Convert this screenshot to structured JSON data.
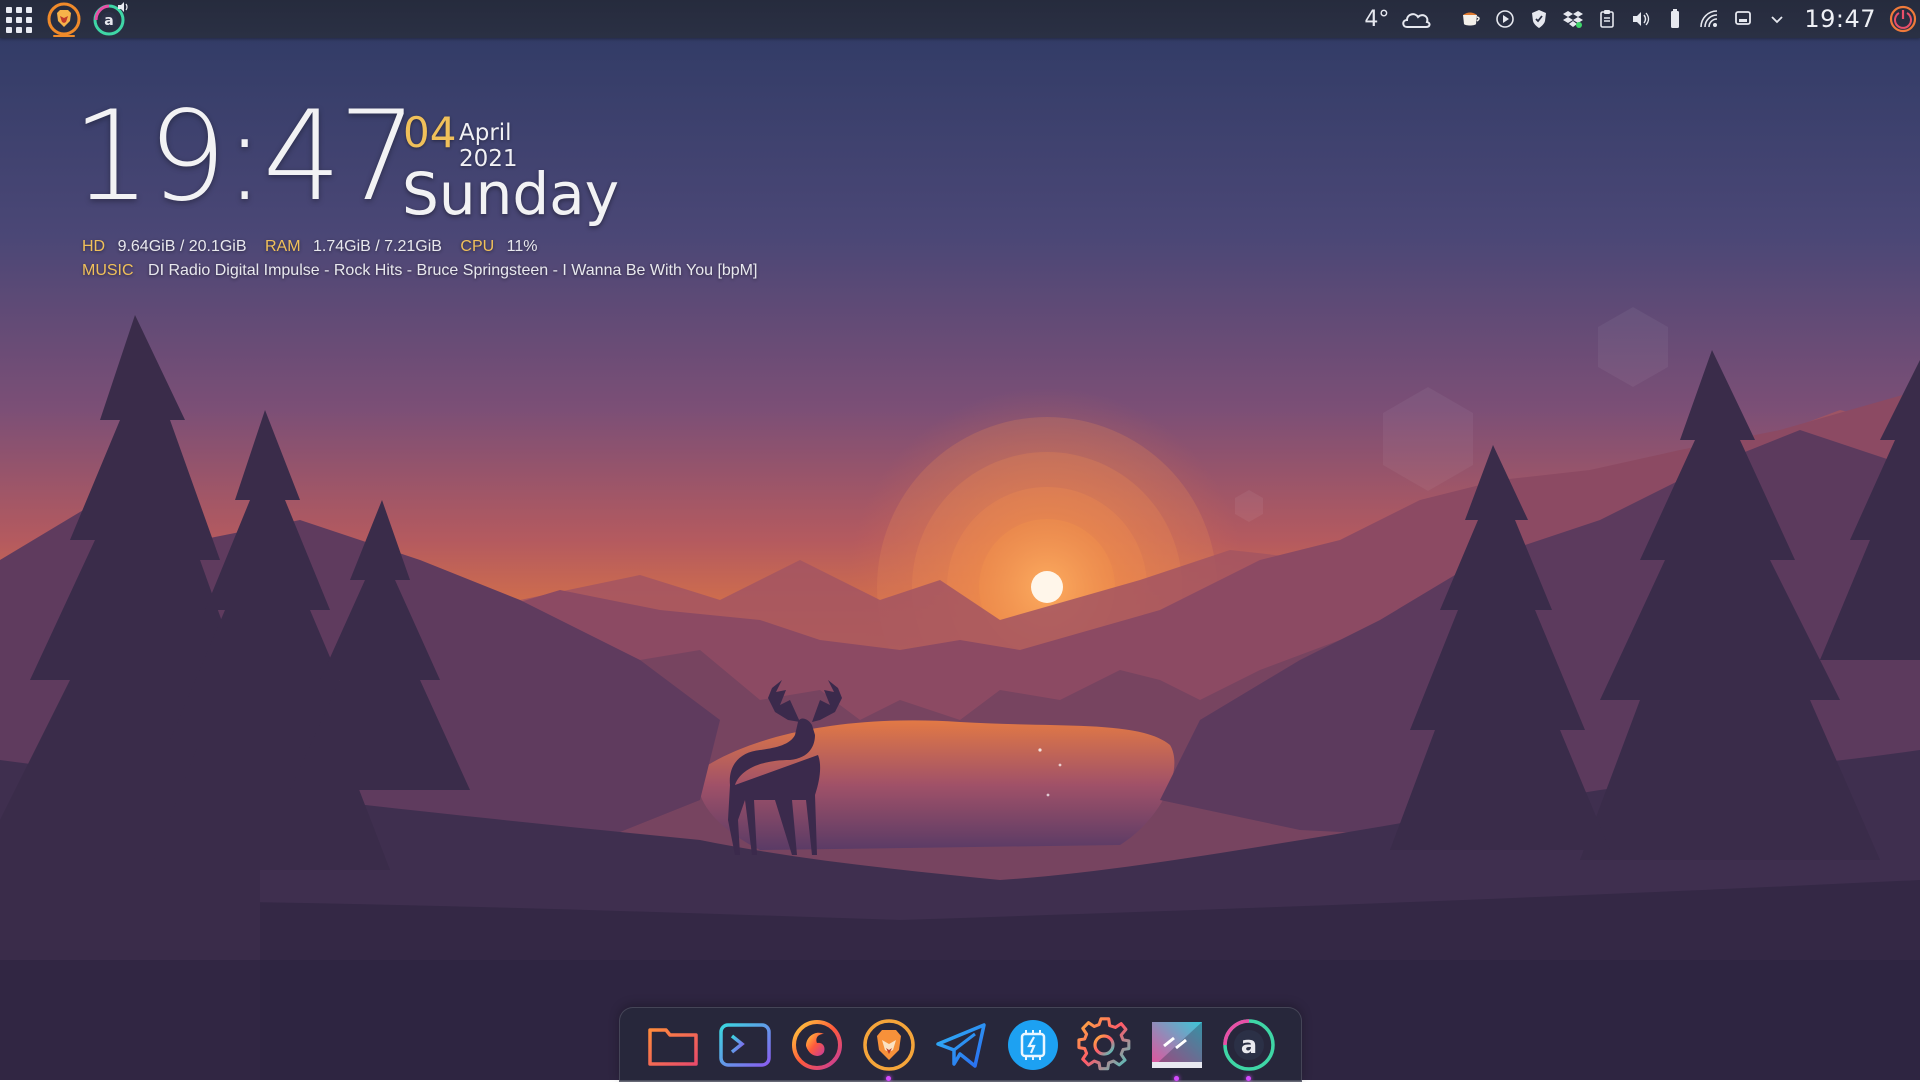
{
  "panel": {
    "launcher_icon": "app-grid-icon",
    "apps": [
      {
        "name": "Brave",
        "icon": "brave-lion-icon"
      },
      {
        "name": "Audacious",
        "icon": "audacious-icon",
        "playing_badge": "speaker-icon"
      }
    ],
    "tray": {
      "weather_temp": "4°",
      "weather_icon": "cloud-icon",
      "icons": [
        "coffee-cup-icon",
        "media-play-icon",
        "shield-icon",
        "dropbox-icon",
        "clipboard-icon",
        "volume-icon",
        "battery-icon",
        "wifi-icon",
        "display-icon",
        "chevron-down-icon"
      ],
      "clock": "19:47",
      "power_icon": "power-icon"
    }
  },
  "desktop": {
    "clock": "19:47",
    "date_day": "04",
    "date_month_year": "April 2021",
    "weekday": "Sunday",
    "sysinfo": {
      "hd_label": "HD",
      "hd_value": "9.64GiB / 20.1GiB",
      "ram_label": "RAM",
      "ram_value": "1.74GiB / 7.21GiB",
      "cpu_label": "CPU",
      "cpu_value": "11%",
      "music_label": "MUSIC",
      "music_value": "DI Radio Digital Impulse - Rock Hits - Bruce Springsteen - I Wanna Be With You [bpM]"
    }
  },
  "dock": {
    "items": [
      {
        "icon": "folder-icon",
        "running": false
      },
      {
        "icon": "terminal-icon",
        "running": false
      },
      {
        "icon": "firefox-icon",
        "running": false
      },
      {
        "icon": "brave-lion-icon",
        "running": true
      },
      {
        "icon": "telegram-icon",
        "running": false
      },
      {
        "icon": "system-monitor-icon",
        "running": false
      },
      {
        "icon": "settings-gear-icon",
        "running": false
      },
      {
        "icon": "kde-connect-icon",
        "running": true
      },
      {
        "icon": "audacious-icon",
        "running": true
      }
    ]
  },
  "colors": {
    "accent_gold": "#f0c05a",
    "panel_bg": "#282d40",
    "dock_dot": "#d54cff"
  }
}
